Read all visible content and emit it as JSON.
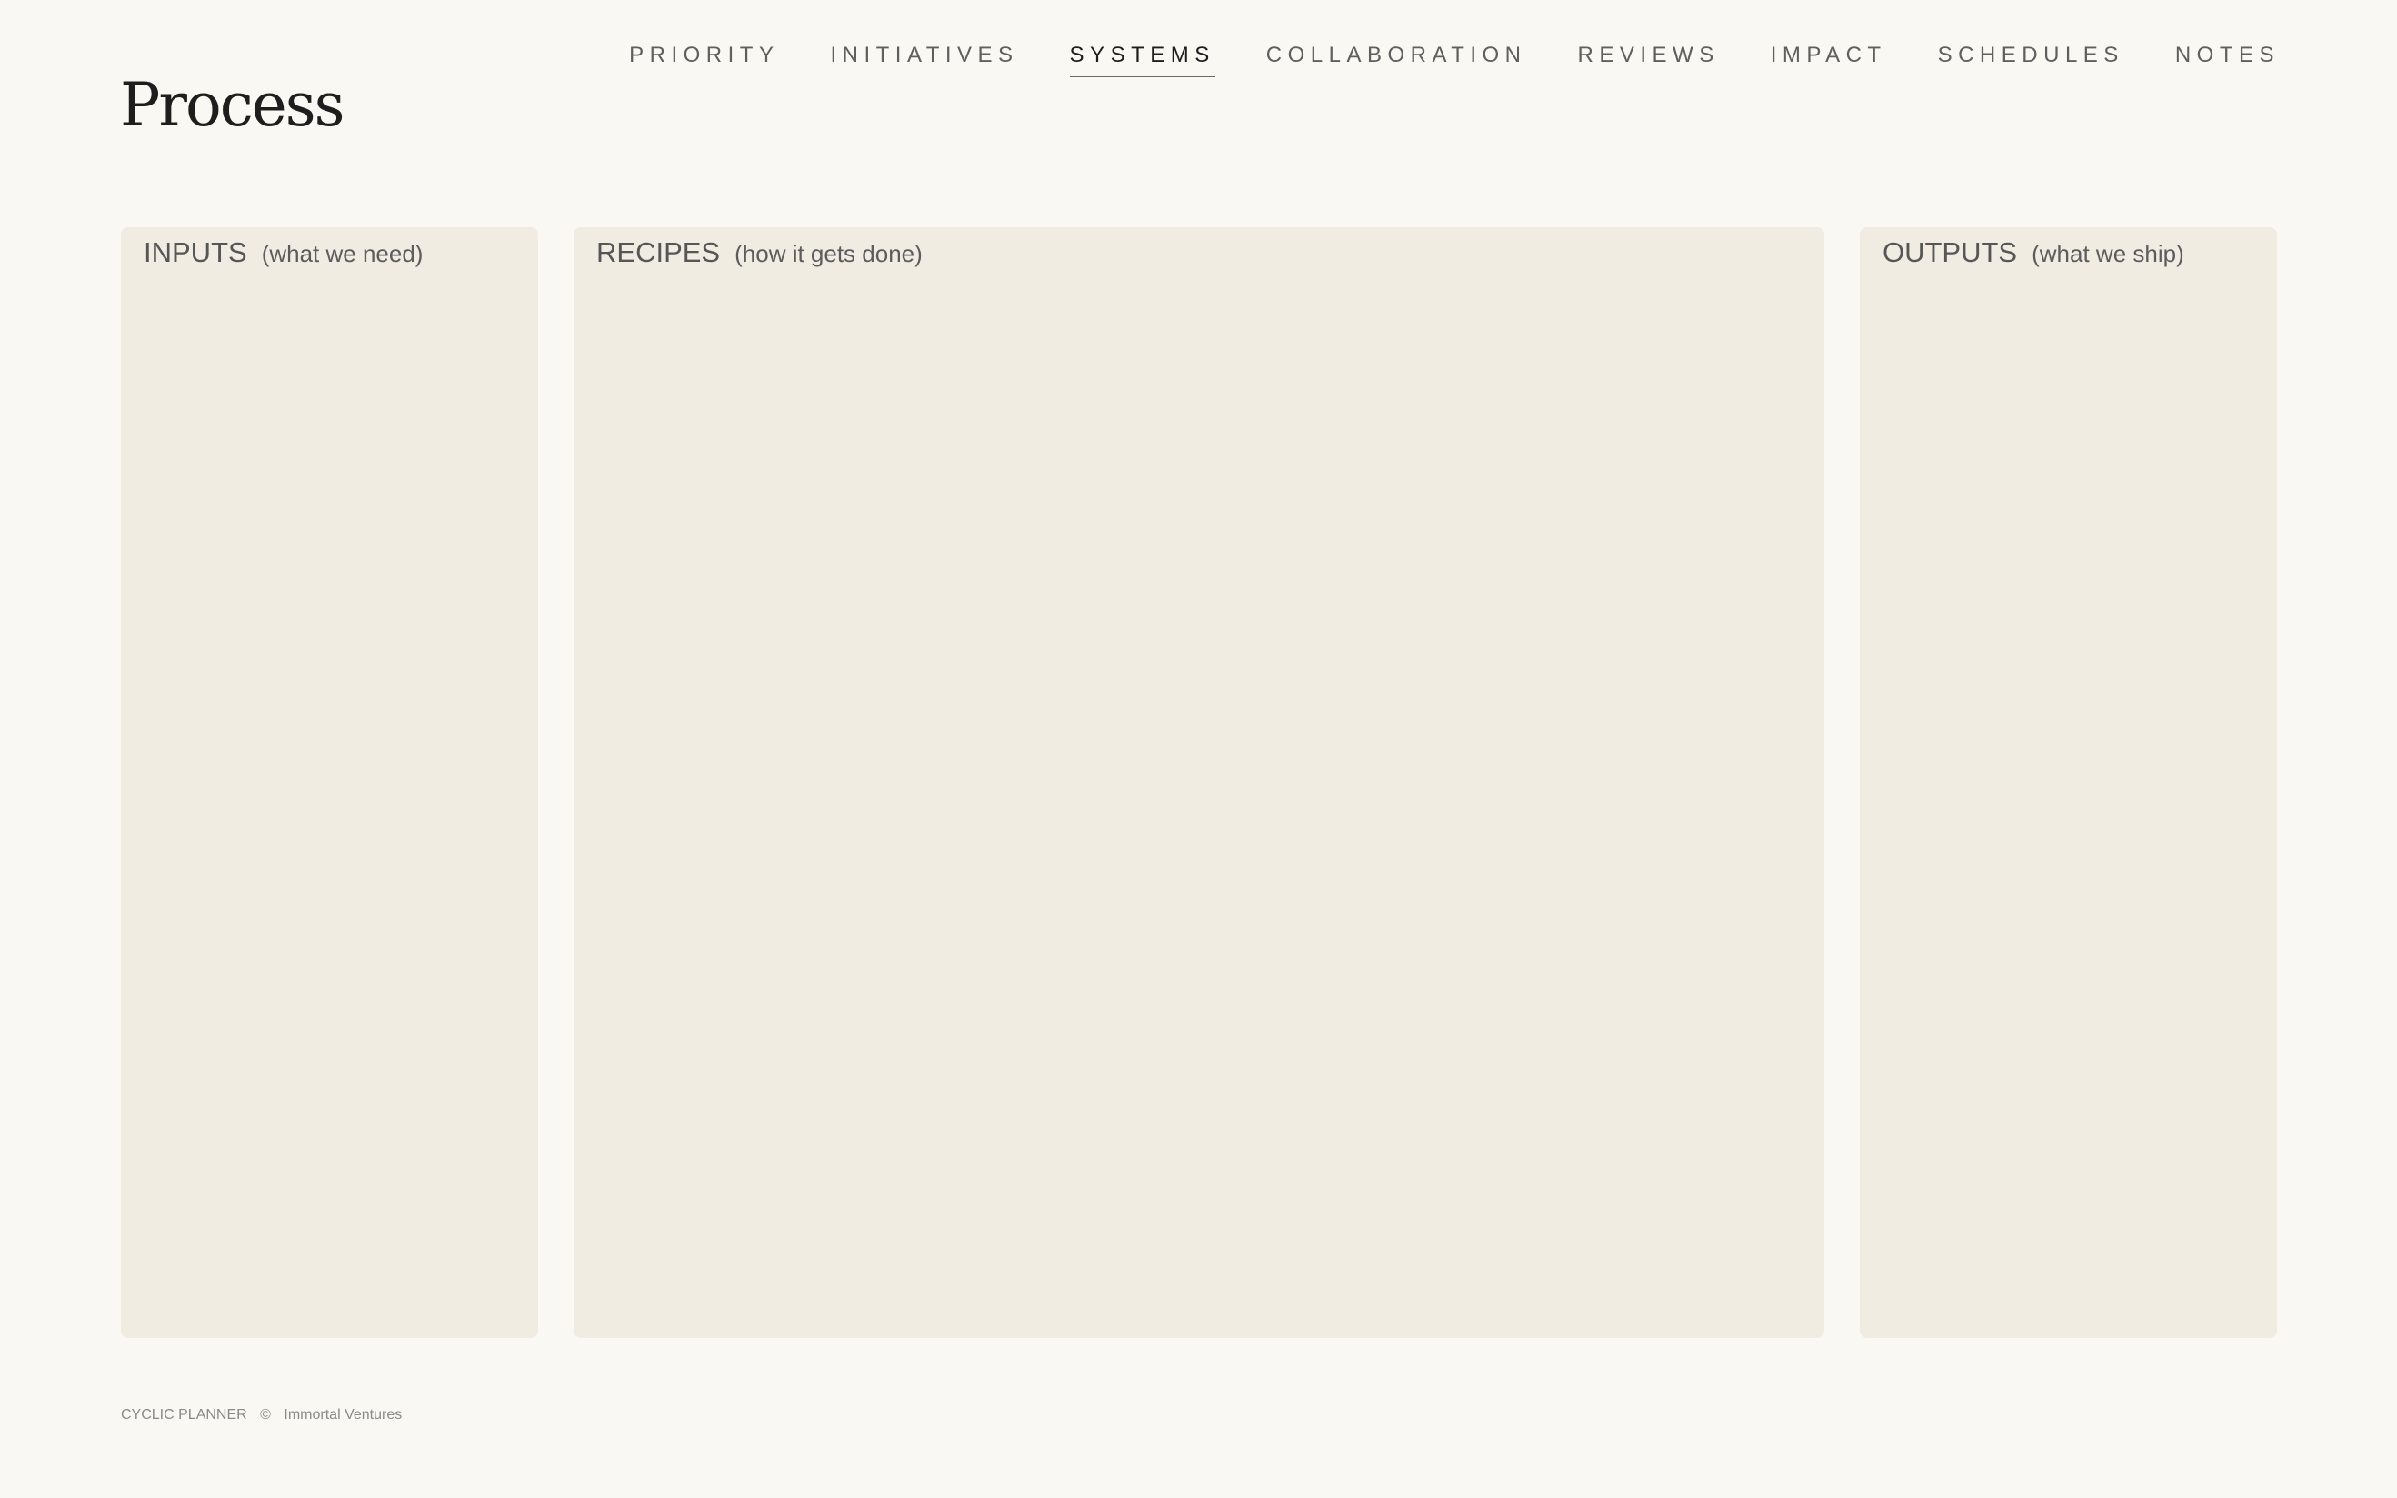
{
  "nav": {
    "items": [
      {
        "label": "PRIORITY"
      },
      {
        "label": "INITIATIVES"
      },
      {
        "label": "SYSTEMS",
        "active": true
      },
      {
        "label": "COLLABORATION"
      },
      {
        "label": "REVIEWS"
      },
      {
        "label": "IMPACT"
      },
      {
        "label": "SCHEDULES"
      },
      {
        "label": "NOTES"
      }
    ]
  },
  "page": {
    "title": "Process"
  },
  "panels": {
    "inputs": {
      "title": "INPUTS",
      "subtitle": "(what we need)"
    },
    "recipes": {
      "title": "RECIPES",
      "subtitle": "(how it gets done)"
    },
    "outputs": {
      "title": "OUTPUTS",
      "subtitle": "(what we ship)"
    }
  },
  "footer": {
    "app_name": "CYCLIC PLANNER",
    "copyright_symbol": "©",
    "company": "Immortal Ventures"
  },
  "colors": {
    "background": "#faf8f2",
    "panel": "#f0ece2",
    "text_dark": "#1e1e1e",
    "text_muted": "#565656"
  }
}
